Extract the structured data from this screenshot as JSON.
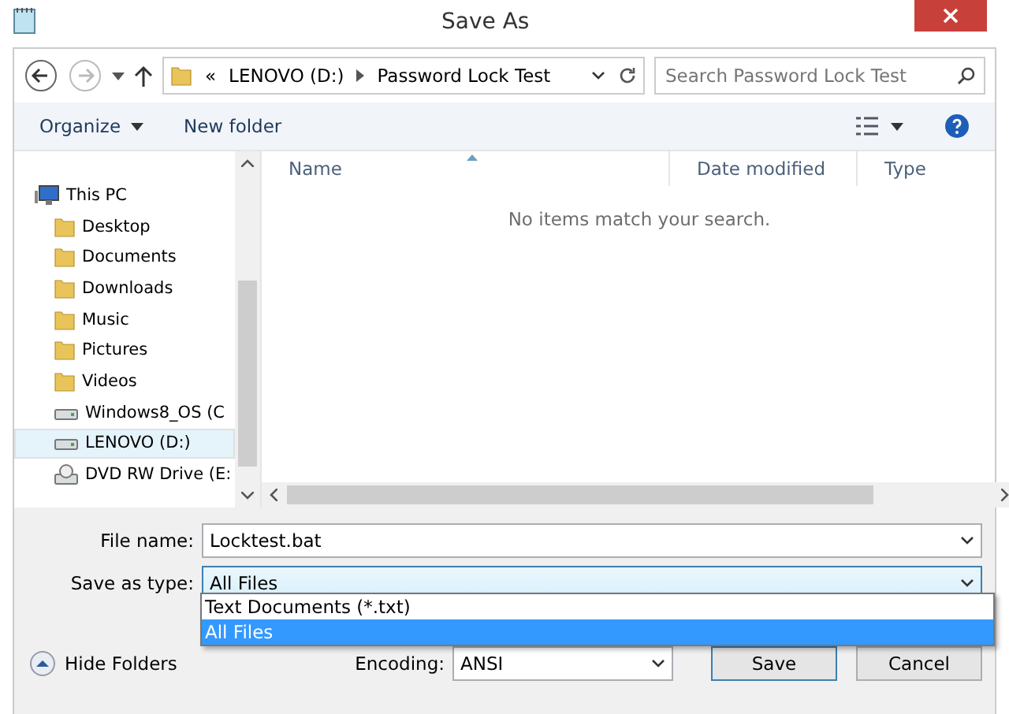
{
  "window": {
    "title": "Save As"
  },
  "address": {
    "crumbs": [
      "«",
      "LENOVO (D:)",
      "Password Lock Test"
    ]
  },
  "search": {
    "placeholder": "Search Password Lock Test"
  },
  "toolbar": {
    "organize": "Organize",
    "new_folder": "New folder"
  },
  "sidebar": {
    "items": [
      {
        "label": "This PC",
        "kind": "pc",
        "selected": false,
        "children": [
          {
            "label": "Desktop",
            "kind": "folder",
            "selected": false
          },
          {
            "label": "Documents",
            "kind": "folder",
            "selected": false
          },
          {
            "label": "Downloads",
            "kind": "folder",
            "selected": false
          },
          {
            "label": "Music",
            "kind": "folder",
            "selected": false
          },
          {
            "label": "Pictures",
            "kind": "folder",
            "selected": false
          },
          {
            "label": "Videos",
            "kind": "folder",
            "selected": false
          },
          {
            "label": "Windows8_OS (C",
            "kind": "drive",
            "selected": false
          },
          {
            "label": "LENOVO (D:)",
            "kind": "drive",
            "selected": true
          },
          {
            "label": "DVD RW Drive (E:",
            "kind": "dvd",
            "selected": false
          }
        ]
      }
    ]
  },
  "table": {
    "columns": [
      "Name",
      "Date modified",
      "Type"
    ],
    "empty_message": "No items match your search."
  },
  "form": {
    "file_name_label": "File name:",
    "file_name": "Locktest.bat",
    "type_label": "Save as type:",
    "type_value": "All Files",
    "type_options": [
      {
        "label": "Text Documents (*.txt)",
        "selected": false
      },
      {
        "label": "All Files",
        "selected": true
      }
    ],
    "hide_folders": "Hide Folders",
    "encoding_label": "Encoding:",
    "encoding": "ANSI",
    "buttons": [
      "Save",
      "Cancel"
    ]
  }
}
